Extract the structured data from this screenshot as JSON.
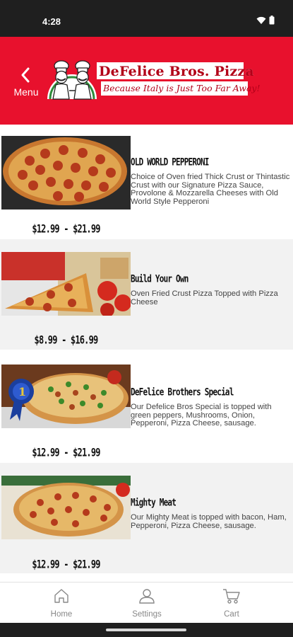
{
  "status_bar": {
    "time": "4:28"
  },
  "header": {
    "back_label": "Menu",
    "brand": "DeFelice Bros. Pizza",
    "tagline": "Because Italy is Just Too Far Away!",
    "brand_color": "#e8112d"
  },
  "items": [
    {
      "name": "OLD WORLD PEPPERONI",
      "description": "Choice of Oven fried Thick Crust or Thintastic Crust with our Signature Pizza Sauce, Provolone & Mozzarella Cheeses with Old World Style Pepperoni",
      "price": "$12.99 - $21.99"
    },
    {
      "name": "Build Your Own",
      "description": "Oven Fried Crust Pizza Topped with Pizza Cheese",
      "price": "$8.99 - $16.99"
    },
    {
      "name": "DeFelice Brothers Special",
      "description": "Our Defelice Bros Special  is topped with green peppers, Mushrooms, Onion, Pepperoni, Pizza Cheese, sausage.",
      "price": "$12.99 - $21.99"
    },
    {
      "name": "Mighty Meat",
      "description": "Our Mighty Meat is topped with bacon, Ham, Pepperoni, Pizza Cheese, sausage.",
      "price": "$12.99 - $21.99"
    }
  ],
  "bottom_nav": [
    {
      "label": "Home",
      "icon": "home-icon"
    },
    {
      "label": "Settings",
      "icon": "person-icon"
    },
    {
      "label": "Cart",
      "icon": "cart-icon"
    }
  ]
}
